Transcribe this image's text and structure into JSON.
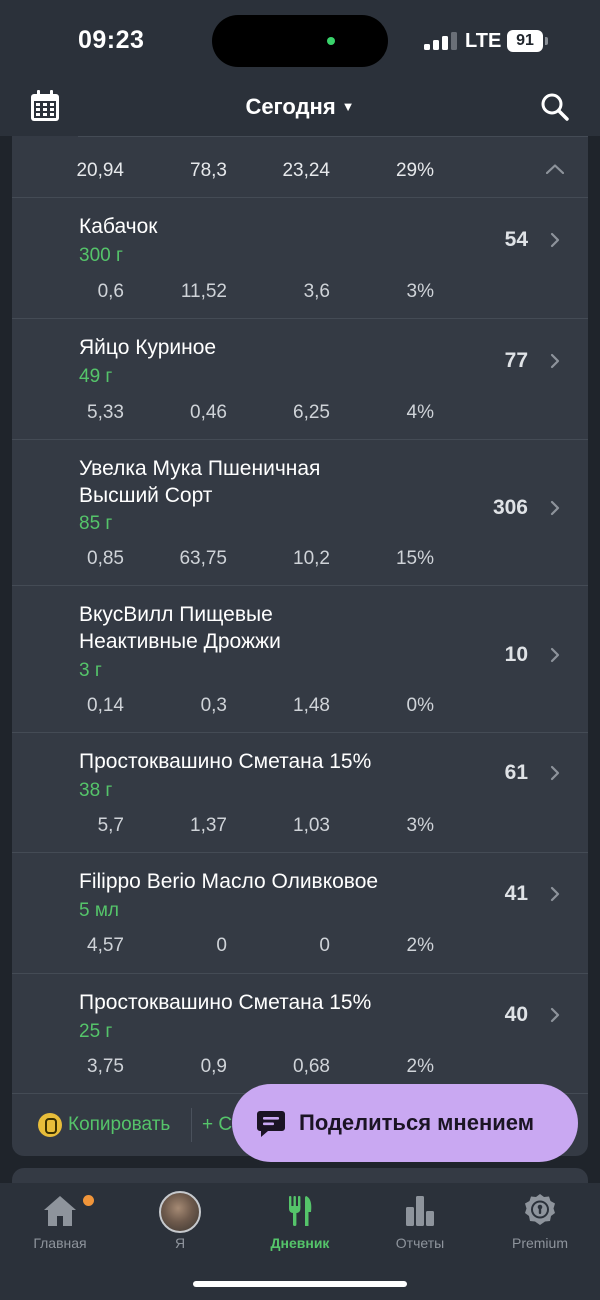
{
  "status_bar": {
    "time": "09:23",
    "network": "LTE",
    "battery": "91"
  },
  "nav": {
    "title": "Сегодня"
  },
  "summary": {
    "values": [
      "20,94",
      "78,3",
      "23,24",
      "29%"
    ]
  },
  "foods": [
    {
      "name": "Кабачок",
      "amount": "300 г",
      "calories": "54",
      "nutrients": [
        "0,6",
        "11,52",
        "3,6",
        "3%"
      ]
    },
    {
      "name": "Яйцо Куриное",
      "amount": "49 г",
      "calories": "77",
      "nutrients": [
        "5,33",
        "0,46",
        "6,25",
        "4%"
      ]
    },
    {
      "name": "Увелка Мука Пшеничная Высший Сорт",
      "amount": "85 г",
      "calories": "306",
      "nutrients": [
        "0,85",
        "63,75",
        "10,2",
        "15%"
      ]
    },
    {
      "name": "ВкусВилл Пищевые Неактивные Дрожжи",
      "amount": "3 г",
      "calories": "10",
      "nutrients": [
        "0,14",
        "0,3",
        "1,48",
        "0%"
      ]
    },
    {
      "name": "Простоквашино Сметана 15%",
      "amount": "38 г",
      "calories": "61",
      "nutrients": [
        "5,7",
        "1,37",
        "1,03",
        "3%"
      ]
    },
    {
      "name": "Filippo Berio Масло Оливковое",
      "amount": "5 мл",
      "calories": "41",
      "nutrients": [
        "4,57",
        "0",
        "0",
        "2%"
      ]
    },
    {
      "name": "Простоквашино Сметана 15%",
      "amount": "25 г",
      "calories": "40",
      "nutrients": [
        "3,75",
        "0,9",
        "0,68",
        "2%"
      ]
    }
  ],
  "footer": {
    "copy_label": "Копировать",
    "add_label": "+ С"
  },
  "feedback_button": {
    "label": "Поделиться мнением"
  },
  "tabs": [
    {
      "label": "Главная",
      "icon": "home-icon"
    },
    {
      "label": "Я",
      "icon": "avatar"
    },
    {
      "label": "Дневник",
      "icon": "cutlery-icon"
    },
    {
      "label": "Отчеты",
      "icon": "bar-chart-icon"
    },
    {
      "label": "Premium",
      "icon": "premium-badge-icon"
    }
  ],
  "colors": {
    "accent_green": "#55c46a",
    "feedback_purple": "#c9a8f2",
    "notification_orange": "#f0953a",
    "card_bg": "#343a44"
  }
}
